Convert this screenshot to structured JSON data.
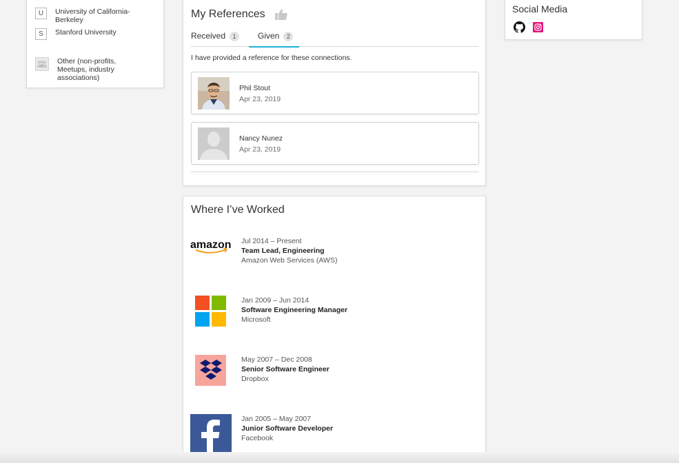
{
  "education": {
    "items": [
      {
        "badge": "U",
        "name": "University of California-Berkeley"
      },
      {
        "badge": "S",
        "name": "Stanford University"
      }
    ],
    "other": "Other (non-profits, Meetups, industry associations)"
  },
  "references": {
    "title": "My References",
    "tabs": [
      {
        "label": "Received",
        "count": "1"
      },
      {
        "label": "Given",
        "count": "2"
      }
    ],
    "active_tab": "Given",
    "description": "I have provided a reference for these connections.",
    "items": [
      {
        "name": "Phil Stout",
        "date": "Apr 23, 2019"
      },
      {
        "name": "Nancy Nunez",
        "date": "Apr 23, 2019"
      }
    ]
  },
  "social": {
    "title": "Social Media",
    "icons": [
      "github-icon",
      "instagram-icon"
    ]
  },
  "work": {
    "title": "Where I’ve Worked",
    "jobs": [
      {
        "dates": "Jul 2014 – Present",
        "role": "Team Lead, Engineering",
        "company": "Amazon Web Services (AWS)",
        "logo": "amazon-logo"
      },
      {
        "dates": "Jan 2009 – Jun 2014",
        "role": "Software Engineering Manager",
        "company": "Microsoft",
        "logo": "microsoft-logo"
      },
      {
        "dates": "May 2007 – Dec 2008",
        "role": "Senior Software Engineer",
        "company": "Dropbox",
        "logo": "dropbox-logo"
      },
      {
        "dates": "Jan 2005 – May 2007",
        "role": "Junior Software Developer",
        "company": "Facebook",
        "logo": "facebook-logo"
      }
    ]
  },
  "colors": {
    "accent": "#1fb3d6",
    "instagram": "#e4157a",
    "microsoft_red": "#f25022",
    "microsoft_green": "#7fba00",
    "microsoft_blue": "#00a4ef",
    "microsoft_yellow": "#ffb900",
    "dropbox_bg": "#f7a59c",
    "dropbox_icon": "#0d1a6e",
    "facebook": "#3b5998"
  }
}
